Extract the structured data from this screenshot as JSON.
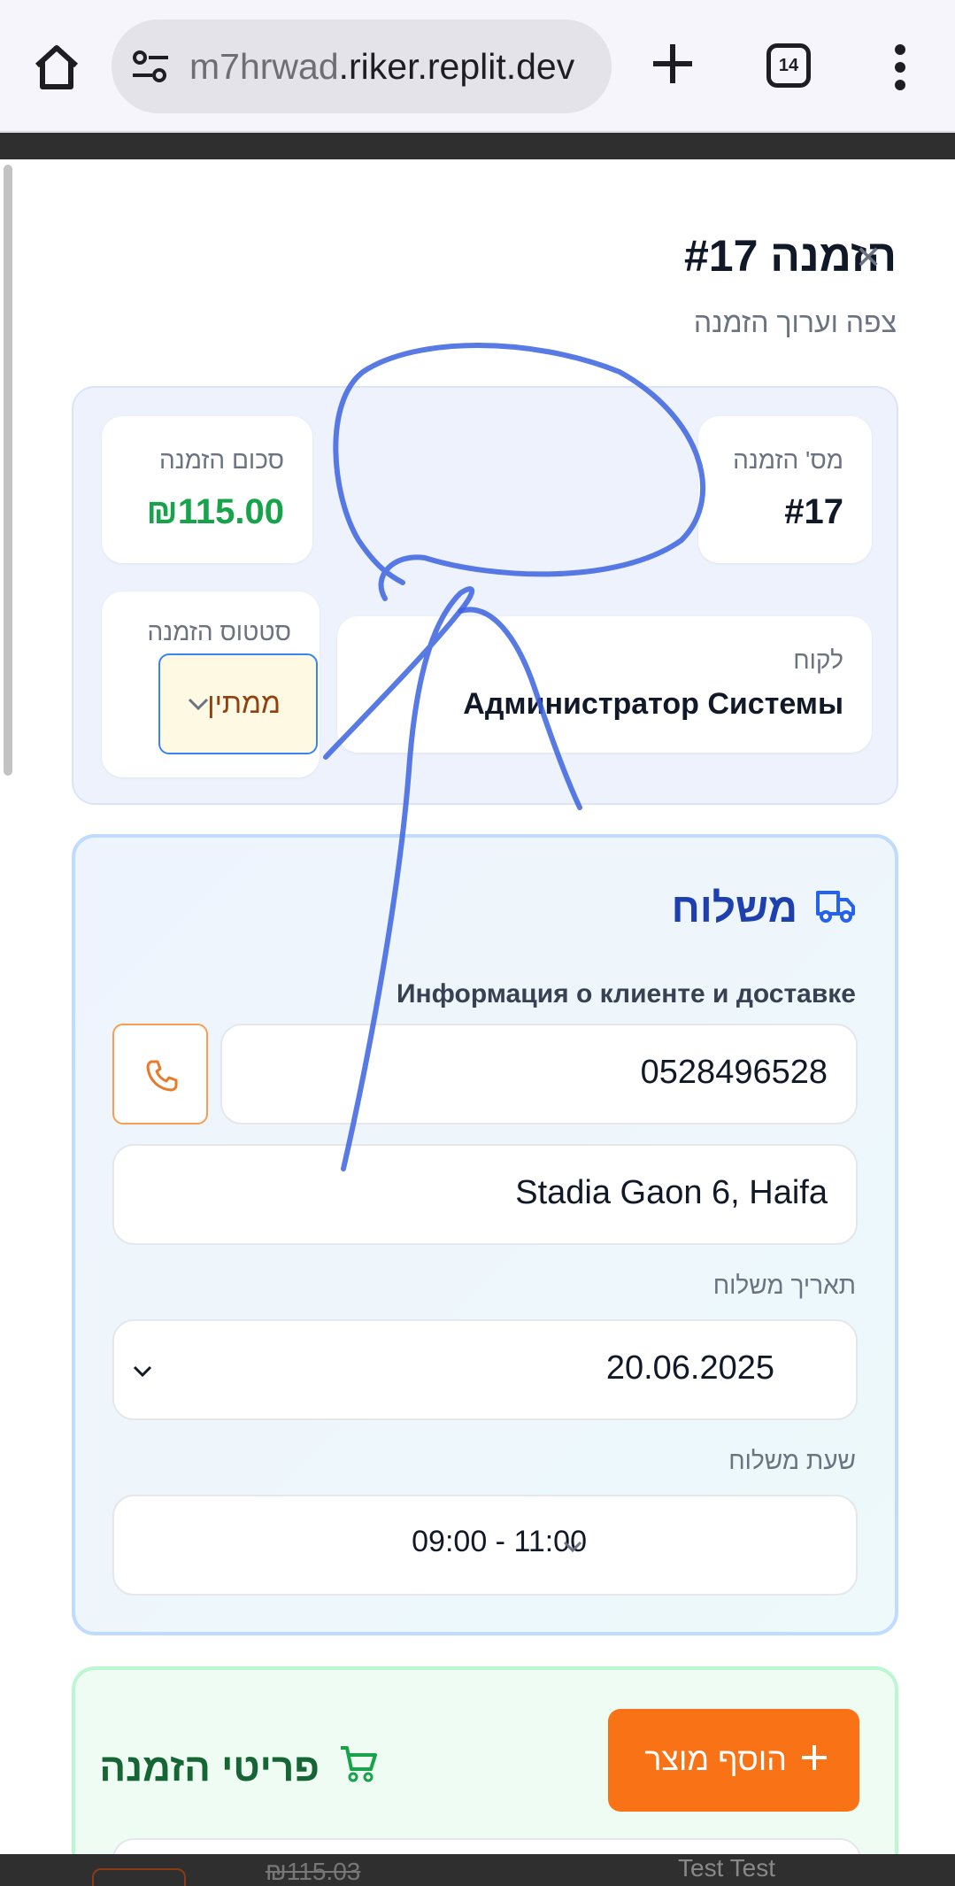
{
  "browser": {
    "url_prefix": "m7hrwad",
    "url_rest": ".riker.replit.dev",
    "tab_count": "14"
  },
  "modal": {
    "title": "הזמנה #17",
    "subtitle": "צפה וערוך הזמנה",
    "order_number_label": "מס' הזמנה",
    "order_number_value": "#17",
    "total_label": "סכום הזמנה",
    "total_value": "₪115.00",
    "customer_label": "לקוח",
    "customer_value": "Администратор Системы",
    "status_label": "סטטוס הזמנה",
    "status_value": "ממתין"
  },
  "shipping": {
    "title": "משלוח",
    "subtitle": "Информация о клиенте и доставке",
    "phone": "0528496528",
    "address": "Stadia Gaon 6, Haifa",
    "date_label": "תאריך משלוח",
    "date_value": "20.06.2025",
    "time_label": "שעת משלוח",
    "time_value": "09:00 - 11:00"
  },
  "items": {
    "title": "פריטי הזמנה",
    "add_label": "הוסף מוצר",
    "peek_price": "₪115.03",
    "peek_name": "Test Test"
  },
  "colors": {
    "accent_blue": "#1e40af",
    "total_green": "#16a34a",
    "add_orange": "#f97316",
    "items_green": "#166534",
    "scribble_blue": "#3b63e0"
  }
}
